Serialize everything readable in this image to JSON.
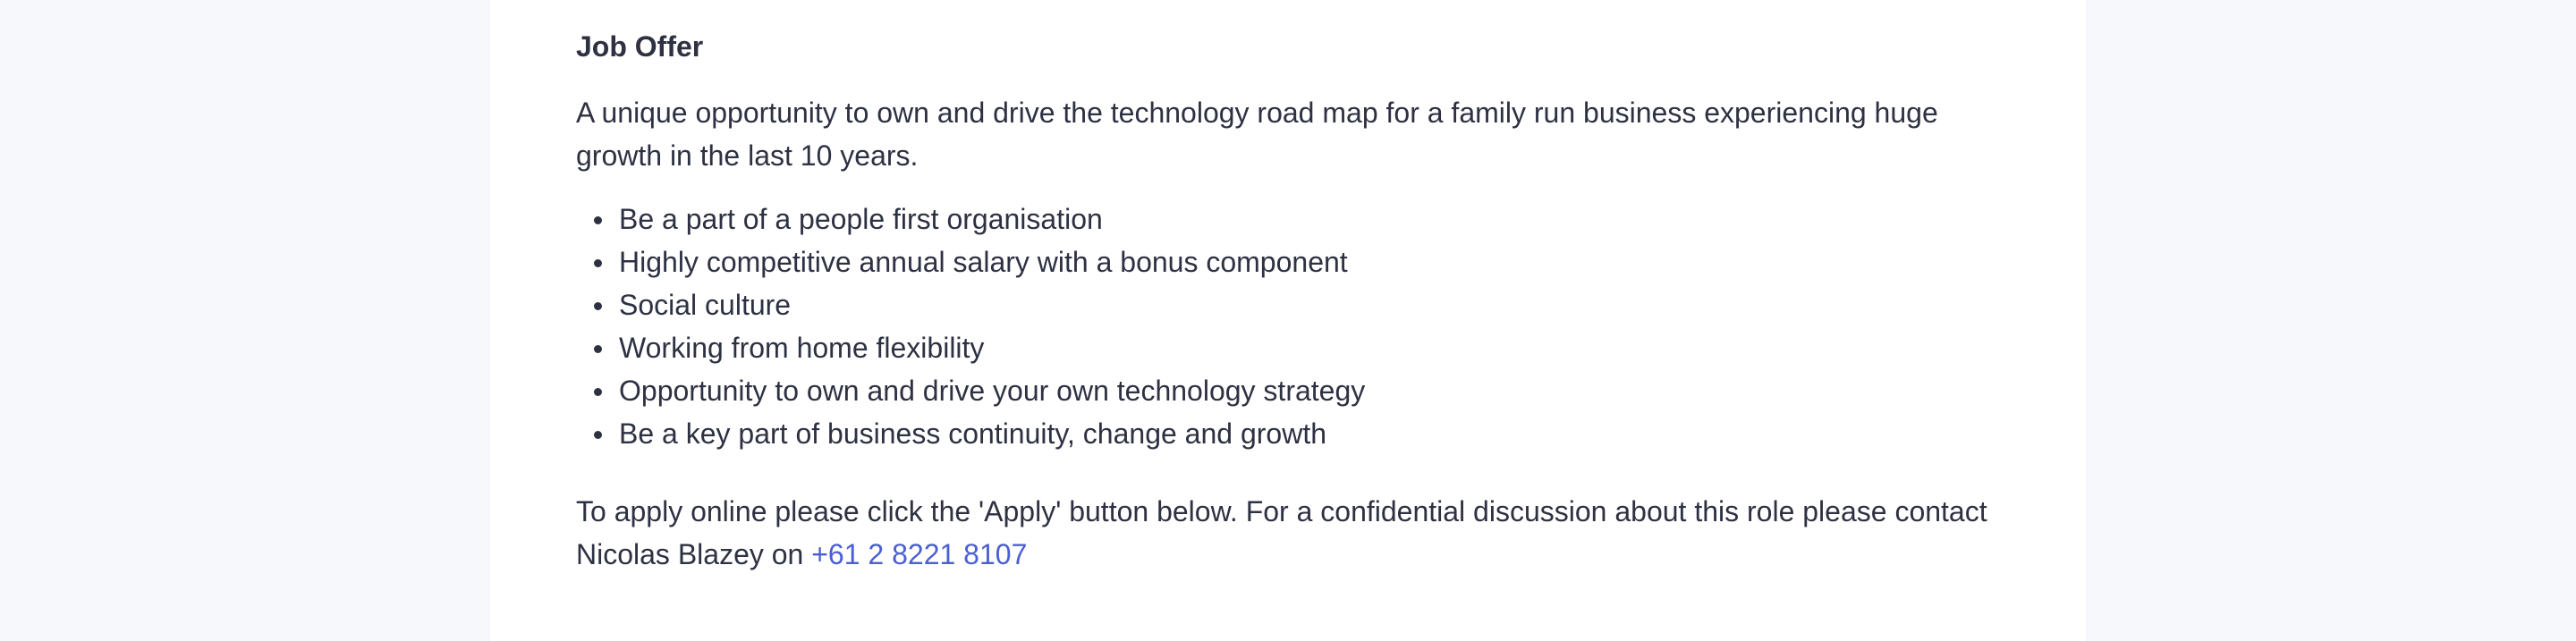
{
  "job_offer": {
    "heading": "Job Offer",
    "intro": "A unique opportunity to own and drive the technology road map for a family run business experiencing huge growth in the last 10 years.",
    "benefits": [
      "Be a part of a people first organisation",
      "Highly competitive annual salary with a bonus component",
      "Social culture",
      "Working from home flexibility",
      "Opportunity to own and drive your own technology strategy",
      "Be a key part of business continuity, change and growth"
    ],
    "apply_text": "To apply online please click the 'Apply' button below. For a confidential discussion about this role please contact Nicolas Blazey on ",
    "phone": "+61 2 8221 8107"
  },
  "colors": {
    "page_background": "#f7f8fc",
    "card_background": "#ffffff",
    "text": "#2d3142",
    "link": "#4a5fd6"
  }
}
